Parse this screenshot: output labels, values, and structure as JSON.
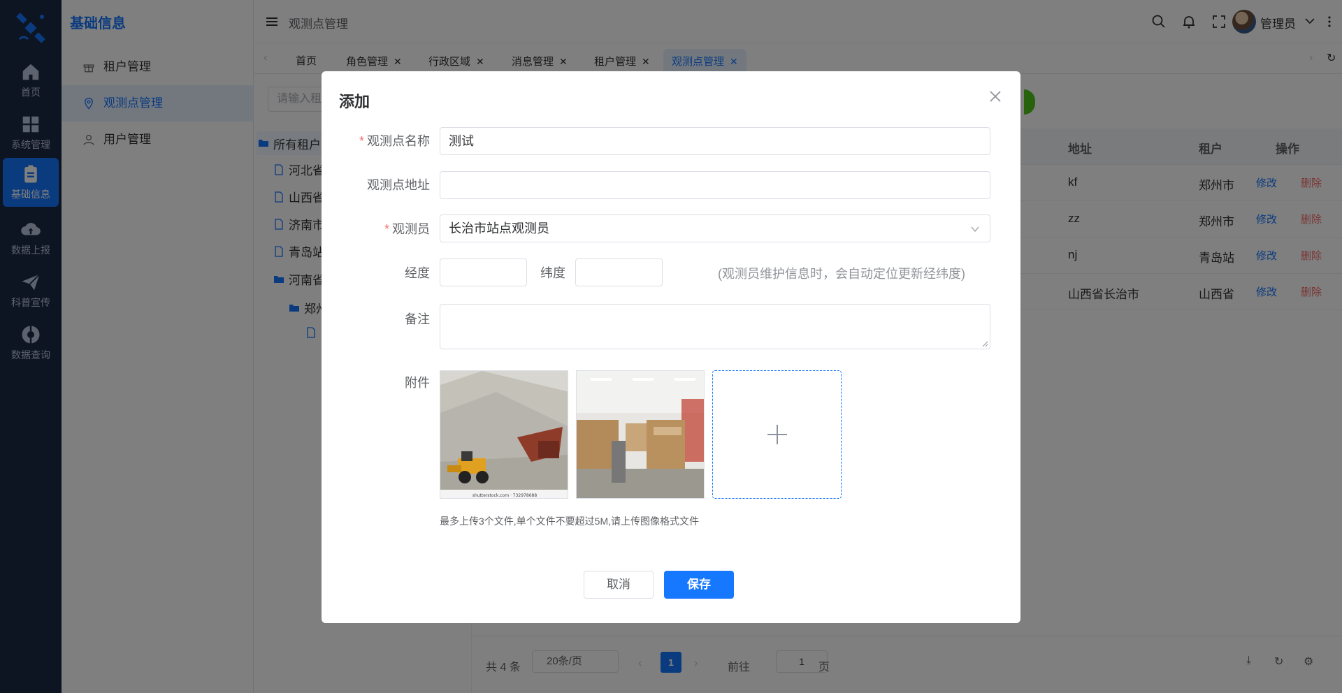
{
  "rail": {
    "items": [
      {
        "label": "首页"
      },
      {
        "label": "系统管理"
      },
      {
        "label": "基础信息"
      },
      {
        "label": "数据上报"
      },
      {
        "label": "科普宣传"
      },
      {
        "label": "数据查询"
      }
    ]
  },
  "subnav": {
    "title": "基础信息",
    "items": [
      {
        "label": "租户管理"
      },
      {
        "label": "观测点管理"
      },
      {
        "label": "用户管理"
      }
    ]
  },
  "header": {
    "breadcrumb": "观测点管理",
    "username": "管理员"
  },
  "tabs": [
    {
      "label": "首页"
    },
    {
      "label": "角色管理"
    },
    {
      "label": "行政区域"
    },
    {
      "label": "消息管理"
    },
    {
      "label": "租户管理"
    },
    {
      "label": "观测点管理"
    }
  ],
  "tree": {
    "search_placeholder": "请输入租",
    "nodes": [
      "所有租户",
      "河北省",
      "山西省",
      "济南市",
      "青岛站",
      "河南省",
      "郑州"
    ]
  },
  "table": {
    "headers": {
      "address": "地址",
      "tenant": "租户",
      "actions": "操作"
    },
    "rows": [
      {
        "address": "kf",
        "tenant": "郑州市"
      },
      {
        "address": "zz",
        "tenant": "郑州市"
      },
      {
        "address": "nj",
        "tenant": "青岛站"
      },
      {
        "address": "山西省长治市",
        "tenant": "山西省"
      }
    ],
    "edit_label": "修改",
    "delete_label": "删除"
  },
  "pager": {
    "total": "共 4 条",
    "page_size": "20条/页",
    "current_page": "1",
    "goto_label": "前往",
    "goto_value": "1",
    "page_unit": "页"
  },
  "dialog": {
    "title": "添加",
    "name_label": "观测点名称",
    "name_value": "测试",
    "address_label": "观测点地址",
    "address_value": "",
    "observer_label": "观测员",
    "observer_value": "长治市站点观测员",
    "longitude_label": "经度",
    "latitude_label": "纬度",
    "coords_hint": "(观测员维护信息时，会自动定位更新经纬度)",
    "remark_label": "备注",
    "attachment_label": "附件",
    "upload_tip": "最多上传3个文件,单个文件不要超过5M,请上传图像格式文件",
    "image1_caption": "shutterstock.com · 732978688",
    "cancel_label": "取消",
    "save_label": "保存"
  },
  "colors": {
    "primary": "#1677ff",
    "danger": "#f56c6c",
    "rail_bg": "#1d2a44"
  }
}
